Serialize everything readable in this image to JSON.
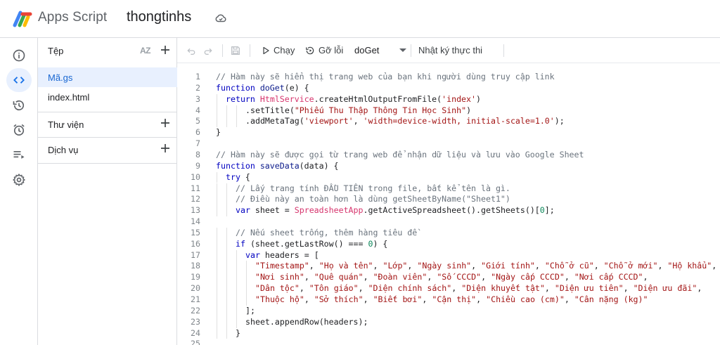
{
  "header": {
    "app_name": "Apps Script",
    "project_name": "thongtinhs",
    "cloud_status_icon": "cloud-sync-icon"
  },
  "rail": {
    "items": [
      {
        "icon": "info-icon",
        "label": "Tổng quan"
      },
      {
        "icon": "code-icon",
        "label": "Trình chỉnh sửa",
        "active": true
      },
      {
        "icon": "history-icon",
        "label": "Lịch sử"
      },
      {
        "icon": "alarm-icon",
        "label": "Trình kích hoạt"
      },
      {
        "icon": "executions-icon",
        "label": "Lần thực thi"
      },
      {
        "icon": "gear-icon",
        "label": "Cài đặt dự án"
      }
    ]
  },
  "files": {
    "header": "Tệp",
    "sort_label": "AZ",
    "items": [
      {
        "name": "Mã.gs",
        "active": true
      },
      {
        "name": "index.html",
        "active": false
      }
    ],
    "libraries": "Thư viện",
    "services": "Dịch vụ"
  },
  "toolbar": {
    "run": "Chạy",
    "debug": "Gỡ lỗi",
    "function_selected": "doGet",
    "execution_log": "Nhật ký thực thi"
  },
  "editor": {
    "active_color": "#1a73e8",
    "lines": [
      {
        "n": "1",
        "indent": 0,
        "tokens": [
          [
            "c-com",
            "// Hàm này sẽ hiển thị trang web của bạn khi người dùng truy cập link"
          ]
        ]
      },
      {
        "n": "2",
        "indent": 0,
        "tokens": [
          [
            "c-kw",
            "function "
          ],
          [
            "c-fn",
            "doGet"
          ],
          [
            "c-plain",
            "(e) {"
          ]
        ]
      },
      {
        "n": "3",
        "indent": 1,
        "tokens": [
          [
            "c-kw",
            "return "
          ],
          [
            "c-cls",
            "HtmlService"
          ],
          [
            "c-plain",
            ".createHtmlOutputFromFile("
          ],
          [
            "c-str",
            "'index'"
          ],
          [
            "c-plain",
            ")"
          ]
        ]
      },
      {
        "n": "4",
        "indent": 3,
        "tokens": [
          [
            "c-plain",
            ".setTitle("
          ],
          [
            "c-str",
            "\"Phiếu Thu Thập Thông Tin Học Sinh\""
          ],
          [
            "c-plain",
            ")"
          ]
        ]
      },
      {
        "n": "5",
        "indent": 3,
        "tokens": [
          [
            "c-plain",
            ".addMetaTag("
          ],
          [
            "c-str",
            "'viewport'"
          ],
          [
            "c-plain",
            ", "
          ],
          [
            "c-str",
            "'width=device-width, initial-scale=1.0'"
          ],
          [
            "c-plain",
            ");"
          ]
        ]
      },
      {
        "n": "6",
        "indent": 0,
        "tokens": [
          [
            "c-plain",
            "}"
          ]
        ]
      },
      {
        "n": "7",
        "indent": 0,
        "tokens": []
      },
      {
        "n": "8",
        "indent": 0,
        "tokens": [
          [
            "c-com",
            "// Hàm này sẽ được gọi từ trang web để nhận dữ liệu và lưu vào Google Sheet"
          ]
        ]
      },
      {
        "n": "9",
        "indent": 0,
        "tokens": [
          [
            "c-kw",
            "function "
          ],
          [
            "c-fn",
            "saveData"
          ],
          [
            "c-plain",
            "(data) {"
          ]
        ]
      },
      {
        "n": "10",
        "indent": 1,
        "tokens": [
          [
            "c-kw",
            "try"
          ],
          [
            "c-plain",
            " {"
          ]
        ]
      },
      {
        "n": "11",
        "indent": 2,
        "tokens": [
          [
            "c-com",
            "// Lấy trang tính ĐẦU TIÊN trong file, bất kể tên là gì."
          ]
        ]
      },
      {
        "n": "12",
        "indent": 2,
        "tokens": [
          [
            "c-com",
            "// Điều này an toàn hơn là dùng getSheetByName(\"Sheet1\")"
          ]
        ]
      },
      {
        "n": "13",
        "indent": 2,
        "tokens": [
          [
            "c-kw",
            "var "
          ],
          [
            "c-plain",
            "sheet = "
          ],
          [
            "c-cls",
            "SpreadsheetApp"
          ],
          [
            "c-plain",
            ".getActiveSpreadsheet().getSheets()["
          ],
          [
            "c-num",
            "0"
          ],
          [
            "c-plain",
            "];"
          ]
        ]
      },
      {
        "n": "14",
        "indent": 0,
        "tokens": []
      },
      {
        "n": "15",
        "indent": 2,
        "tokens": [
          [
            "c-com",
            "// Nếu sheet trống, thêm hàng tiêu đề"
          ]
        ]
      },
      {
        "n": "16",
        "indent": 2,
        "tokens": [
          [
            "c-kw",
            "if "
          ],
          [
            "c-plain",
            "(sheet.getLastRow() === "
          ],
          [
            "c-num",
            "0"
          ],
          [
            "c-plain",
            ") {"
          ]
        ]
      },
      {
        "n": "17",
        "indent": 3,
        "tokens": [
          [
            "c-kw",
            "var "
          ],
          [
            "c-plain",
            "headers = ["
          ]
        ]
      },
      {
        "n": "18",
        "indent": 4,
        "tokens": [
          [
            "c-str",
            "\"Timestamp\""
          ],
          [
            "c-plain",
            ", "
          ],
          [
            "c-str",
            "\"Họ và tên\""
          ],
          [
            "c-plain",
            ", "
          ],
          [
            "c-str",
            "\"Lớp\""
          ],
          [
            "c-plain",
            ", "
          ],
          [
            "c-str",
            "\"Ngày sinh\""
          ],
          [
            "c-plain",
            ", "
          ],
          [
            "c-str",
            "\"Giới tính\""
          ],
          [
            "c-plain",
            ", "
          ],
          [
            "c-str",
            "\"Chỗ ở cũ\""
          ],
          [
            "c-plain",
            ", "
          ],
          [
            "c-str",
            "\"Chỗ ở mới\""
          ],
          [
            "c-plain",
            ", "
          ],
          [
            "c-str",
            "\"Hộ khẩu\""
          ],
          [
            "c-plain",
            ","
          ]
        ]
      },
      {
        "n": "19",
        "indent": 4,
        "tokens": [
          [
            "c-str",
            "\"Nơi sinh\""
          ],
          [
            "c-plain",
            ", "
          ],
          [
            "c-str",
            "\"Quê quán\""
          ],
          [
            "c-plain",
            ", "
          ],
          [
            "c-str",
            "\"Đoàn viên\""
          ],
          [
            "c-plain",
            ", "
          ],
          [
            "c-str",
            "\"Số CCCD\""
          ],
          [
            "c-plain",
            ", "
          ],
          [
            "c-str",
            "\"Ngày cấp CCCD\""
          ],
          [
            "c-plain",
            ", "
          ],
          [
            "c-str",
            "\"Nơi cấp CCCD\""
          ],
          [
            "c-plain",
            ","
          ]
        ]
      },
      {
        "n": "20",
        "indent": 4,
        "tokens": [
          [
            "c-str",
            "\"Dân tộc\""
          ],
          [
            "c-plain",
            ", "
          ],
          [
            "c-str",
            "\"Tôn giáo\""
          ],
          [
            "c-plain",
            ", "
          ],
          [
            "c-str",
            "\"Diện chính sách\""
          ],
          [
            "c-plain",
            ", "
          ],
          [
            "c-str",
            "\"Diện khuyết tật\""
          ],
          [
            "c-plain",
            ", "
          ],
          [
            "c-str",
            "\"Diện ưu tiên\""
          ],
          [
            "c-plain",
            ", "
          ],
          [
            "c-str",
            "\"Diện ưu đãi\""
          ],
          [
            "c-plain",
            ","
          ]
        ]
      },
      {
        "n": "21",
        "indent": 4,
        "tokens": [
          [
            "c-str",
            "\"Thuộc hộ\""
          ],
          [
            "c-plain",
            ", "
          ],
          [
            "c-str",
            "\"Sở thích\""
          ],
          [
            "c-plain",
            ", "
          ],
          [
            "c-str",
            "\"Biết bơi\""
          ],
          [
            "c-plain",
            ", "
          ],
          [
            "c-str",
            "\"Cận thị\""
          ],
          [
            "c-plain",
            ", "
          ],
          [
            "c-str",
            "\"Chiều cao (cm)\""
          ],
          [
            "c-plain",
            ", "
          ],
          [
            "c-str",
            "\"Cân nặng (kg)\""
          ]
        ]
      },
      {
        "n": "22",
        "indent": 3,
        "tokens": [
          [
            "c-plain",
            "];"
          ]
        ]
      },
      {
        "n": "23",
        "indent": 3,
        "tokens": [
          [
            "c-plain",
            "sheet.appendRow(headers);"
          ]
        ]
      },
      {
        "n": "24",
        "indent": 2,
        "tokens": [
          [
            "c-plain",
            "}"
          ]
        ]
      },
      {
        "n": "25",
        "indent": 0,
        "tokens": []
      }
    ]
  }
}
